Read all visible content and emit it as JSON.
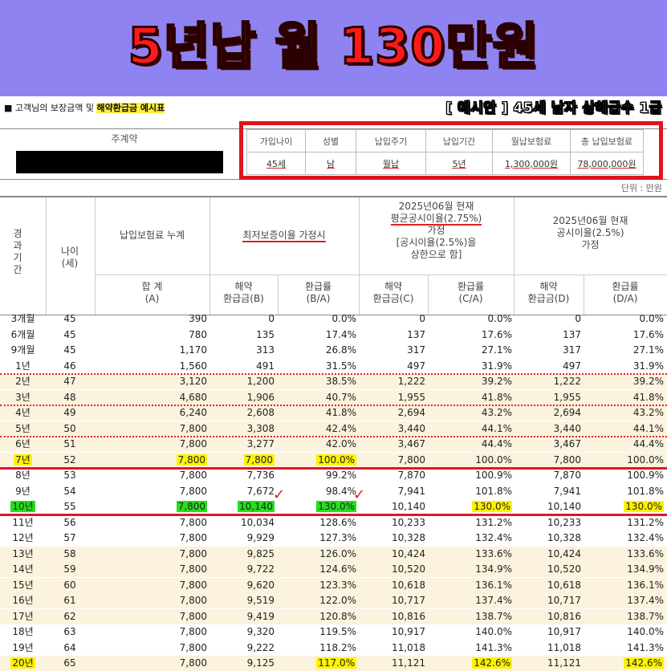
{
  "banner": {
    "title": "5년납 월 130만원"
  },
  "caption": {
    "prefix": "■ 고객님의 보장금액 및 ",
    "highlight": "해약환급금 예시표"
  },
  "example_label": "[ 예시안 ] 45세 남자 상해급수 1급",
  "contract": {
    "label": "주계약",
    "headers": [
      "가입나이",
      "성별",
      "납입주기",
      "납입기간",
      "월납보험료",
      "총 납입보험료"
    ],
    "values": [
      "45세",
      "남",
      "월납",
      "5년",
      "1,300,000원",
      "78,000,000원"
    ]
  },
  "unit": "단위 : 만원",
  "table_header": {
    "period": "경과기간",
    "age": "나이(세)",
    "premium_cum": "납입보험료 누계",
    "min_rate": "최저보증이율 가정시",
    "avg_rate_l1": "2025년06월 현재",
    "avg_rate_l2": "평균공시이율(2.75%)",
    "avg_rate_l3": "가정",
    "avg_rate_l4": "[공시이율(2.5%)을",
    "avg_rate_l5": "상한으로 함]",
    "pub_rate_l1": "2025년06월 현재",
    "pub_rate_l2": "공시이율(2.5%)",
    "pub_rate_l3": "가정",
    "sum_l1": "합 계",
    "sum_l2": "(A)",
    "b_l1": "해약",
    "b_l2": "환급금(B)",
    "ba_l1": "환급률",
    "ba_l2": "(B/A)",
    "c_l1": "해약",
    "c_l2": "환급금(C)",
    "ca_l1": "환급률",
    "ca_l2": "(C/A)",
    "d_l1": "해약",
    "d_l2": "환급금(D)",
    "da_l1": "환급률",
    "da_l2": "(D/A)"
  },
  "rows": [
    {
      "p": "3개월",
      "age": "45",
      "a": "390",
      "b": "0",
      "ba": "0.0%",
      "c": "0",
      "ca": "0.0%",
      "d": "0",
      "da": "0.0%"
    },
    {
      "p": "6개월",
      "age": "45",
      "a": "780",
      "b": "135",
      "ba": "17.4%",
      "c": "137",
      "ca": "17.6%",
      "d": "137",
      "da": "17.6%"
    },
    {
      "p": "9개월",
      "age": "45",
      "a": "1,170",
      "b": "313",
      "ba": "26.8%",
      "c": "317",
      "ca": "27.1%",
      "d": "317",
      "da": "27.1%"
    },
    {
      "p": "1년",
      "age": "46",
      "a": "1,560",
      "b": "491",
      "ba": "31.5%",
      "c": "497",
      "ca": "31.9%",
      "d": "497",
      "da": "31.9%"
    },
    {
      "p": "2년",
      "age": "47",
      "a": "3,120",
      "b": "1,200",
      "ba": "38.5%",
      "c": "1,222",
      "ca": "39.2%",
      "d": "1,222",
      "da": "39.2%"
    },
    {
      "p": "3년",
      "age": "48",
      "a": "4,680",
      "b": "1,906",
      "ba": "40.7%",
      "c": "1,955",
      "ca": "41.8%",
      "d": "1,955",
      "da": "41.8%"
    },
    {
      "p": "4년",
      "age": "49",
      "a": "6,240",
      "b": "2,608",
      "ba": "41.8%",
      "c": "2,694",
      "ca": "43.2%",
      "d": "2,694",
      "da": "43.2%"
    },
    {
      "p": "5년",
      "age": "50",
      "a": "7,800",
      "b": "3,308",
      "ba": "42.4%",
      "c": "3,440",
      "ca": "44.1%",
      "d": "3,440",
      "da": "44.1%"
    },
    {
      "p": "6년",
      "age": "51",
      "a": "7,800",
      "b": "3,277",
      "ba": "42.0%",
      "c": "3,467",
      "ca": "44.4%",
      "d": "3,467",
      "da": "44.4%"
    },
    {
      "p": "7년",
      "age": "52",
      "a": "7,800",
      "b": "7,800",
      "ba": "100.0%",
      "c": "7,800",
      "ca": "100.0%",
      "d": "7,800",
      "da": "100.0%"
    },
    {
      "p": "8년",
      "age": "53",
      "a": "7,800",
      "b": "7,736",
      "ba": "99.2%",
      "c": "7,870",
      "ca": "100.9%",
      "d": "7,870",
      "da": "100.9%"
    },
    {
      "p": "9년",
      "age": "54",
      "a": "7,800",
      "b": "7,672",
      "ba": "98.4%",
      "c": "7,941",
      "ca": "101.8%",
      "d": "7,941",
      "da": "101.8%"
    },
    {
      "p": "10년",
      "age": "55",
      "a": "7,800",
      "b": "10,140",
      "ba": "130.0%",
      "c": "10,140",
      "ca": "130.0%",
      "d": "10,140",
      "da": "130.0%"
    },
    {
      "p": "11년",
      "age": "56",
      "a": "7,800",
      "b": "10,034",
      "ba": "128.6%",
      "c": "10,233",
      "ca": "131.2%",
      "d": "10,233",
      "da": "131.2%"
    },
    {
      "p": "12년",
      "age": "57",
      "a": "7,800",
      "b": "9,929",
      "ba": "127.3%",
      "c": "10,328",
      "ca": "132.4%",
      "d": "10,328",
      "da": "132.4%"
    },
    {
      "p": "13년",
      "age": "58",
      "a": "7,800",
      "b": "9,825",
      "ba": "126.0%",
      "c": "10,424",
      "ca": "133.6%",
      "d": "10,424",
      "da": "133.6%"
    },
    {
      "p": "14년",
      "age": "59",
      "a": "7,800",
      "b": "9,722",
      "ba": "124.6%",
      "c": "10,520",
      "ca": "134.9%",
      "d": "10,520",
      "da": "134.9%"
    },
    {
      "p": "15년",
      "age": "60",
      "a": "7,800",
      "b": "9,620",
      "ba": "123.3%",
      "c": "10,618",
      "ca": "136.1%",
      "d": "10,618",
      "da": "136.1%"
    },
    {
      "p": "16년",
      "age": "61",
      "a": "7,800",
      "b": "9,519",
      "ba": "122.0%",
      "c": "10,717",
      "ca": "137.4%",
      "d": "10,717",
      "da": "137.4%"
    },
    {
      "p": "17년",
      "age": "62",
      "a": "7,800",
      "b": "9,419",
      "ba": "120.8%",
      "c": "10,816",
      "ca": "138.7%",
      "d": "10,816",
      "da": "138.7%"
    },
    {
      "p": "18년",
      "age": "63",
      "a": "7,800",
      "b": "9,320",
      "ba": "119.5%",
      "c": "10,917",
      "ca": "140.0%",
      "d": "10,917",
      "da": "140.0%"
    },
    {
      "p": "19년",
      "age": "64",
      "a": "7,800",
      "b": "9,222",
      "ba": "118.2%",
      "c": "11,018",
      "ca": "141.3%",
      "d": "11,018",
      "da": "141.3%"
    },
    {
      "p": "20년",
      "age": "65",
      "a": "7,800",
      "b": "9,125",
      "ba": "117.0%",
      "c": "11,121",
      "ca": "142.6%",
      "d": "11,121",
      "da": "142.6%"
    }
  ],
  "colors": {
    "banner_bg": "#8f83f2",
    "title_red": "#ff1a1a",
    "highlight_yellow": "#fff200",
    "highlight_green": "#24e01e",
    "mark_red": "#e0141d"
  },
  "check_icon": "✓"
}
